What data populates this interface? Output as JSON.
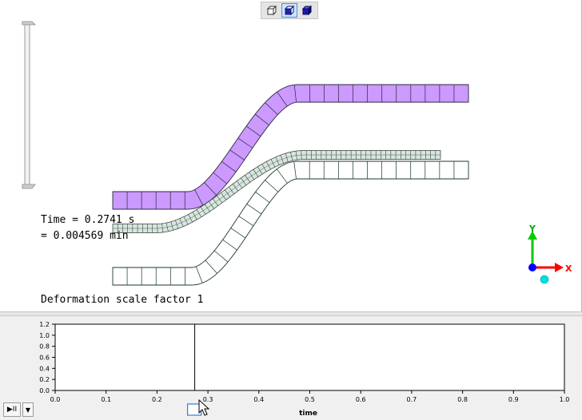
{
  "view_toolbar": {
    "buttons": [
      {
        "name": "wireframe-view",
        "icon": "wireframe-cube-icon",
        "active": false
      },
      {
        "name": "solid-view",
        "icon": "solid-cube-icon",
        "active": true
      },
      {
        "name": "shaded-view",
        "icon": "shaded-cube-icon",
        "active": false
      }
    ]
  },
  "overlay": {
    "time_line1": "Time = 0.2741 s",
    "time_line2": "= 0.004569 min",
    "deformation": "Deformation scale factor 1"
  },
  "triad": {
    "x_label": "X",
    "y_label": "Y",
    "x_color": "#ff0000",
    "y_color": "#00cc00",
    "z_color": "#0000ff"
  },
  "colors": {
    "purple_fill": "#cc99ff",
    "mesh_fill": "#d9e6df",
    "outline": "#1a3a2a"
  },
  "timeline": {
    "play_label": "▶II",
    "dropdown_label": "▼",
    "xlabel": "time",
    "x_ticks": [
      "0.0",
      "0.1",
      "0.2",
      "0.3",
      "0.4",
      "0.5",
      "0.6",
      "0.7",
      "0.8",
      "0.9",
      "1.0"
    ],
    "y_ticks": [
      "0.0",
      "0.2",
      "0.4",
      "0.6",
      "0.8",
      "1.0",
      "1.2"
    ],
    "current_time": 0.2741
  }
}
